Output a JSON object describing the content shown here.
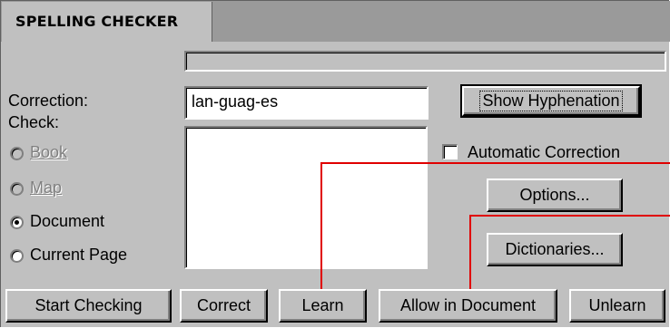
{
  "window": {
    "tab_title": "SPELLING CHECKER"
  },
  "correction": {
    "label": "Correction:",
    "value": "lan-guag-es"
  },
  "check": {
    "label": "Check:",
    "options": [
      {
        "label": "Book",
        "selected": false,
        "disabled": true
      },
      {
        "label": "Map",
        "selected": false,
        "disabled": true
      },
      {
        "label": "Document",
        "selected": true,
        "disabled": false
      },
      {
        "label": "Current Page",
        "selected": false,
        "disabled": false
      }
    ]
  },
  "buttons": {
    "show_hyphenation": "Show Hyphenation",
    "options": "Options...",
    "dictionaries": "Dictionaries...",
    "start_checking": "Start Checking",
    "correct": "Correct",
    "learn": "Learn",
    "allow_in_document": "Allow in Document",
    "unlearn": "Unlearn"
  },
  "automatic_correction": {
    "label": "Automatic Correction",
    "checked": false
  },
  "colors": {
    "dialog_bg": "#c0c0c0",
    "callout_line": "#e00000"
  }
}
